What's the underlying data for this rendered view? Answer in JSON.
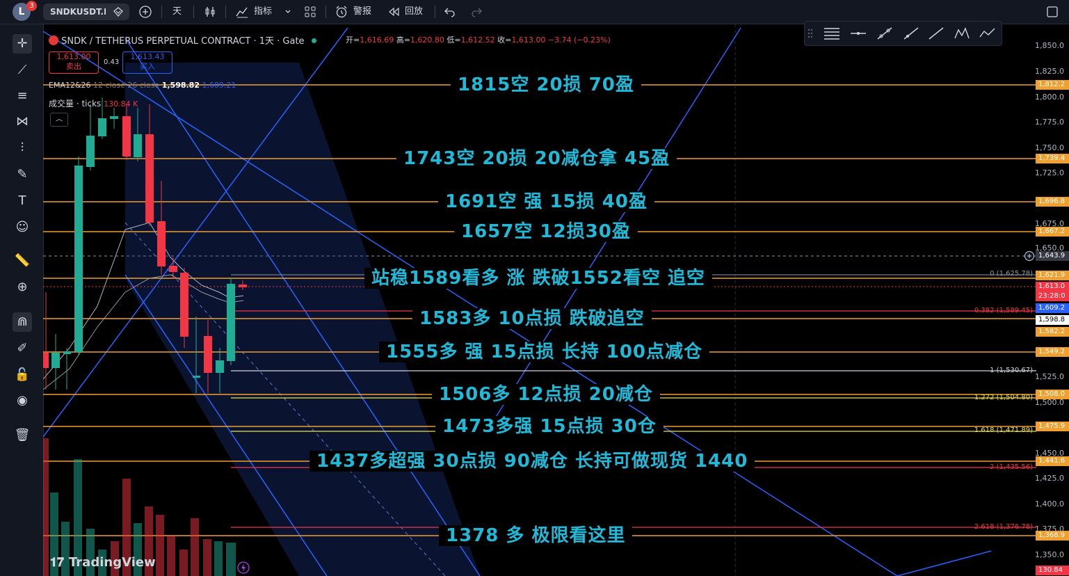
{
  "topbar": {
    "avatar_letter": "L",
    "notification_count": "3",
    "symbol": "SNDKUSDT.P",
    "interval": "天",
    "indicators_label": "指标",
    "alert_label": "警报",
    "replay_label": "回放"
  },
  "legend": {
    "title": "SNDK / TETHERUS PERPETUAL CONTRACT · 1天 · Gate",
    "open_k": "开=",
    "open_v": "1,616.69",
    "high_k": "高=",
    "high_v": "1,620.80",
    "low_k": "低=",
    "low_v": "1,612.52",
    "close_k": "收=",
    "close_v": "1,613.00",
    "change": "−3.74 (−0.23%)",
    "sell_price": "1,613.00",
    "sell_label": "卖出",
    "spread": "0.43",
    "buy_price": "1,613.43",
    "buy_label": "买入",
    "ema_name": "EMA12&26",
    "ema_params": "12 close 26 close",
    "ema_v1": "1,598.82",
    "ema_v2": "1,609.21",
    "volume_name": "成交量 · ticks",
    "volume_value": "130.84 K"
  },
  "annotations": [
    "1815空  20损 70盈",
    "1743空  20损  20减仓拿   45盈",
    "1691空 强  15损 40盈",
    "1657空 12损30盈",
    "站稳1589看多 涨    跌破1552看空 追空",
    "1583多  10点损  跌破追空",
    "1555多 强 15点损  长持 100点减仓",
    "1506多 12点损  20减仓",
    "1473多强 15点损 30仓",
    "1437多超强   30点损     90减仓  长持可做现货 1440",
    "1378 多   极限看这里"
  ],
  "price_axis": [
    "1,850.0",
    "1,825.0",
    "1,800.0",
    "1,775.0",
    "1,750.0",
    "1,725.0",
    "1,675.0",
    "1,650.0",
    "1,525.0",
    "1,500.0",
    "1,450.0",
    "1,425.0",
    "1,400.0",
    "1,375.0",
    "1,350.0"
  ],
  "price_tags": [
    {
      "text": "1,812.2",
      "color": "#f0a030"
    },
    {
      "text": "1,739.4",
      "color": "#f0a030"
    },
    {
      "text": "1,696.8",
      "color": "#f0a030"
    },
    {
      "text": "1,667.2",
      "color": "#f0a030"
    },
    {
      "text": "1,643.9",
      "color": "#363a45"
    },
    {
      "text": "1,621.9",
      "color": "#f0a030"
    },
    {
      "text": "1,613.0",
      "color": "#f23645"
    },
    {
      "text": "23:28:0",
      "color": "#f23645"
    },
    {
      "text": "1,609.2",
      "color": "#2962ff"
    },
    {
      "text": "1,598.8",
      "color": "#ffffff"
    },
    {
      "text": "1,582.2",
      "color": "#f0a030"
    },
    {
      "text": "1,549.2",
      "color": "#f0a030"
    },
    {
      "text": "1,508.0",
      "color": "#f0a030"
    },
    {
      "text": "1,475.9",
      "color": "#f0a030"
    },
    {
      "text": "1,441.6",
      "color": "#f0a030"
    },
    {
      "text": "1,368.9",
      "color": "#f0a030"
    },
    {
      "text": "130.84",
      "color": "#f23645"
    }
  ],
  "fib_labels": [
    {
      "text": "0 (1,625.78)",
      "color": "#9598a1"
    },
    {
      "text": "0.382 (1,589.45)",
      "color": "#f23645"
    },
    {
      "text": "1 (1,530.67)",
      "color": "#d1d4dc"
    },
    {
      "text": "1.272 (1,504.80)",
      "color": "#f0e040"
    },
    {
      "text": "1.618 (1,471.89)",
      "color": "#f0e040"
    },
    {
      "text": "2 (1,435.56)",
      "color": "#f23645"
    },
    {
      "text": "2.618 (1,376.78)",
      "color": "#f23645"
    }
  ],
  "branding": "TradingView"
}
